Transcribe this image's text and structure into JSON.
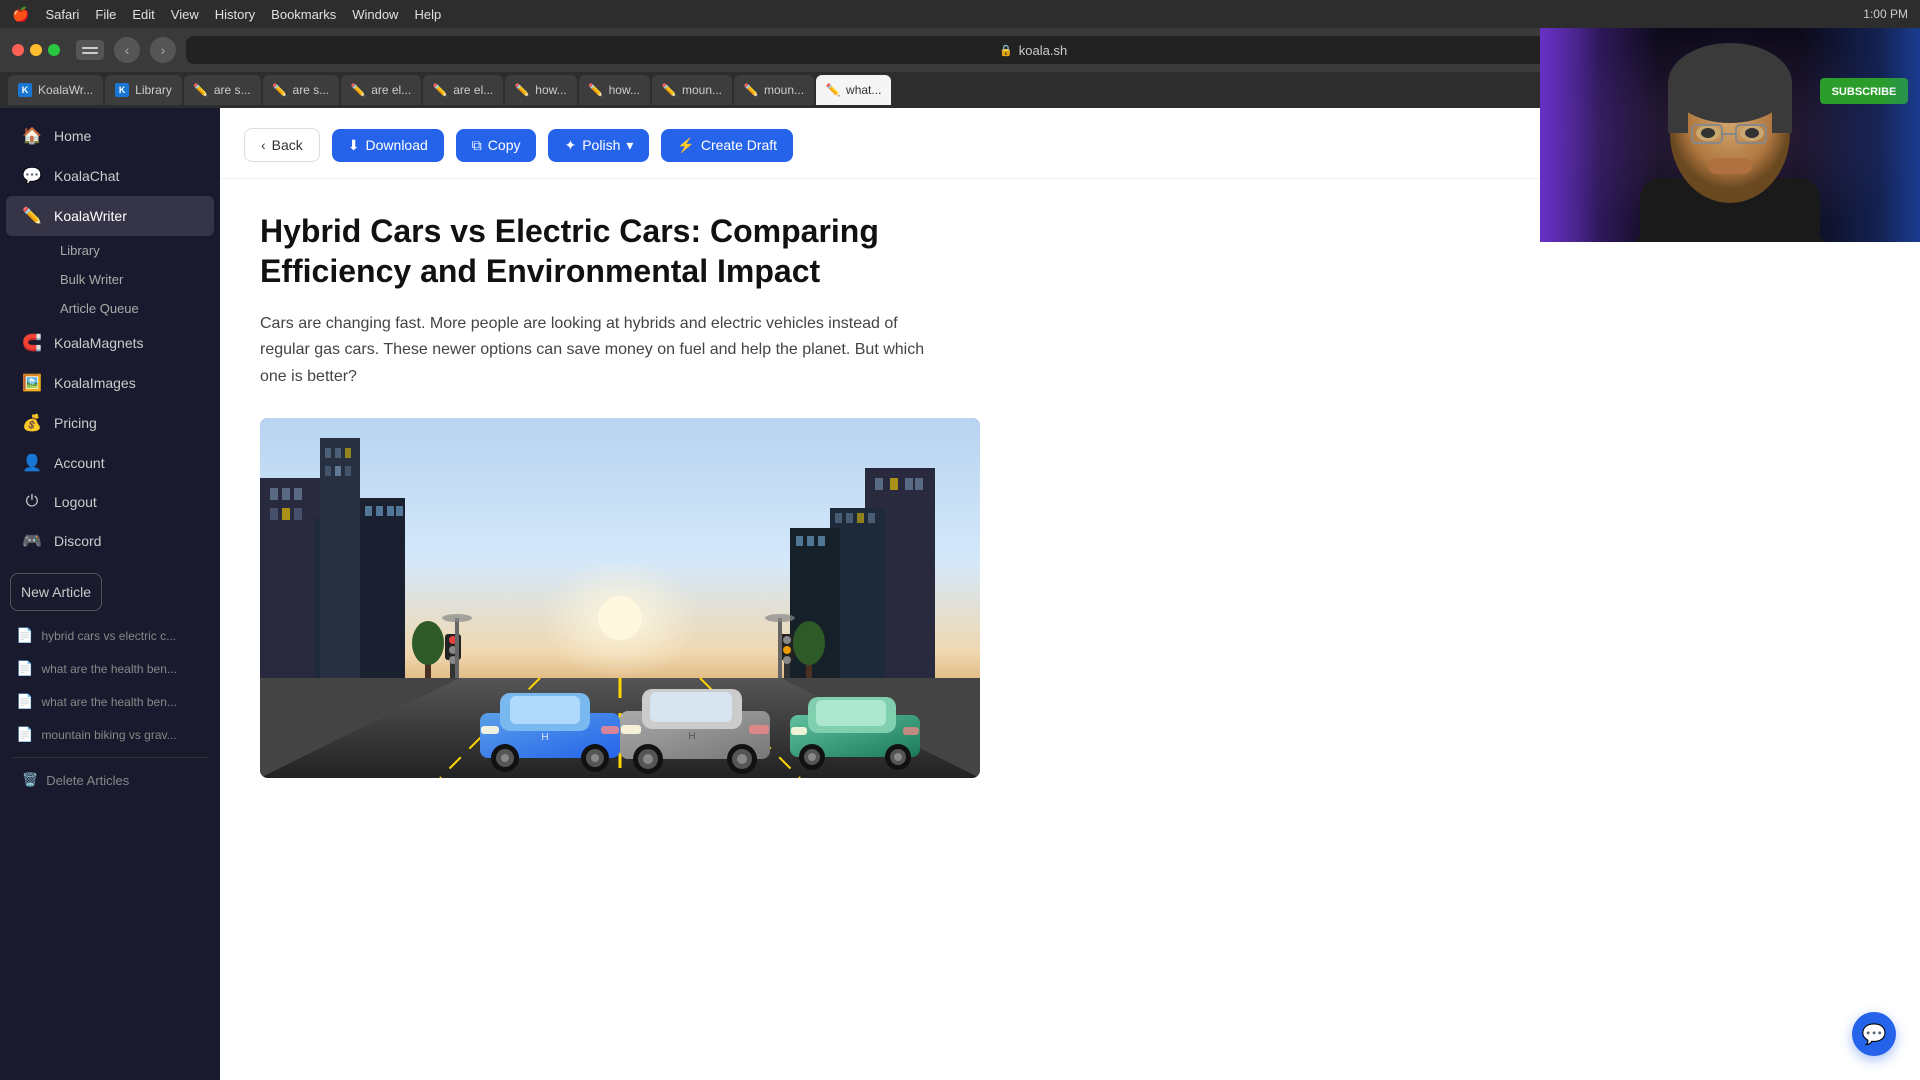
{
  "mac": {
    "apple": "🍎",
    "menus": [
      "Safari",
      "File",
      "Edit",
      "View",
      "History",
      "Bookmarks",
      "Window",
      "Help"
    ]
  },
  "browser": {
    "url": "koala.sh",
    "tabs": [
      {
        "id": "koalawriter",
        "label": "KoalaWr...",
        "type": "koala",
        "active": false
      },
      {
        "id": "library",
        "label": "Library",
        "type": "koala",
        "active": false
      },
      {
        "id": "tab1",
        "label": "are s...",
        "type": "pen",
        "active": false
      },
      {
        "id": "tab2",
        "label": "are s...",
        "type": "pen",
        "active": false
      },
      {
        "id": "tab3",
        "label": "are el...",
        "type": "pen",
        "active": false
      },
      {
        "id": "tab4",
        "label": "are el...",
        "type": "pen",
        "active": false
      },
      {
        "id": "tab5",
        "label": "how...",
        "type": "pen",
        "active": false
      },
      {
        "id": "tab6",
        "label": "how...",
        "type": "pen",
        "active": false
      },
      {
        "id": "tab7",
        "label": "moun...",
        "type": "pen",
        "active": false
      },
      {
        "id": "tab8",
        "label": "moun...",
        "type": "pen",
        "active": false
      },
      {
        "id": "tab9",
        "label": "what...",
        "type": "pen",
        "active": true
      }
    ]
  },
  "sidebar": {
    "items": [
      {
        "id": "home",
        "label": "Home",
        "icon": "🏠",
        "active": false
      },
      {
        "id": "koalachat",
        "label": "KoalaChat",
        "icon": "💬",
        "active": false
      },
      {
        "id": "koalawriter",
        "label": "KoalaWriter",
        "icon": "✏️",
        "active": true
      },
      {
        "id": "koalamagnets",
        "label": "KoalaMagnets",
        "icon": "🧲",
        "active": false
      },
      {
        "id": "koalaimages",
        "label": "KoalaImages",
        "icon": "🖼️",
        "active": false
      },
      {
        "id": "pricing",
        "label": "Pricing",
        "icon": "💰",
        "active": false
      },
      {
        "id": "account",
        "label": "Account",
        "icon": "👤",
        "active": false
      },
      {
        "id": "logout",
        "label": "Logout",
        "icon": "⏻",
        "active": false
      },
      {
        "id": "discord",
        "label": "Discord",
        "icon": "🎮",
        "active": false
      }
    ],
    "sub_items": [
      {
        "id": "library",
        "label": "Library"
      },
      {
        "id": "bulk-writer",
        "label": "Bulk Writer"
      },
      {
        "id": "article-queue",
        "label": "Article Queue"
      }
    ],
    "new_article_label": "New Article",
    "recent_articles": [
      {
        "id": "article1",
        "label": "hybrid cars vs electric c..."
      },
      {
        "id": "article2",
        "label": "what are the health ben..."
      },
      {
        "id": "article3",
        "label": "what are the health ben..."
      },
      {
        "id": "article4",
        "label": "mountain biking vs grav..."
      }
    ],
    "delete_label": "Delete Articles"
  },
  "toolbar": {
    "back_label": "Back",
    "download_label": "Download",
    "copy_label": "Copy",
    "polish_label": "Polish",
    "create_draft_label": "Create Draft"
  },
  "article": {
    "title": "Hybrid Cars vs Electric Cars: Comparing Efficiency and Environmental Impact",
    "intro": "Cars are changing fast. More people are looking at hybrids and electric vehicles instead of regular gas cars. These newer options can save money on fuel and help the planet. But which one is better?"
  },
  "webcam": {
    "subscribe_label": "SUBSCRIBE"
  },
  "chat": {
    "icon": "💬"
  }
}
